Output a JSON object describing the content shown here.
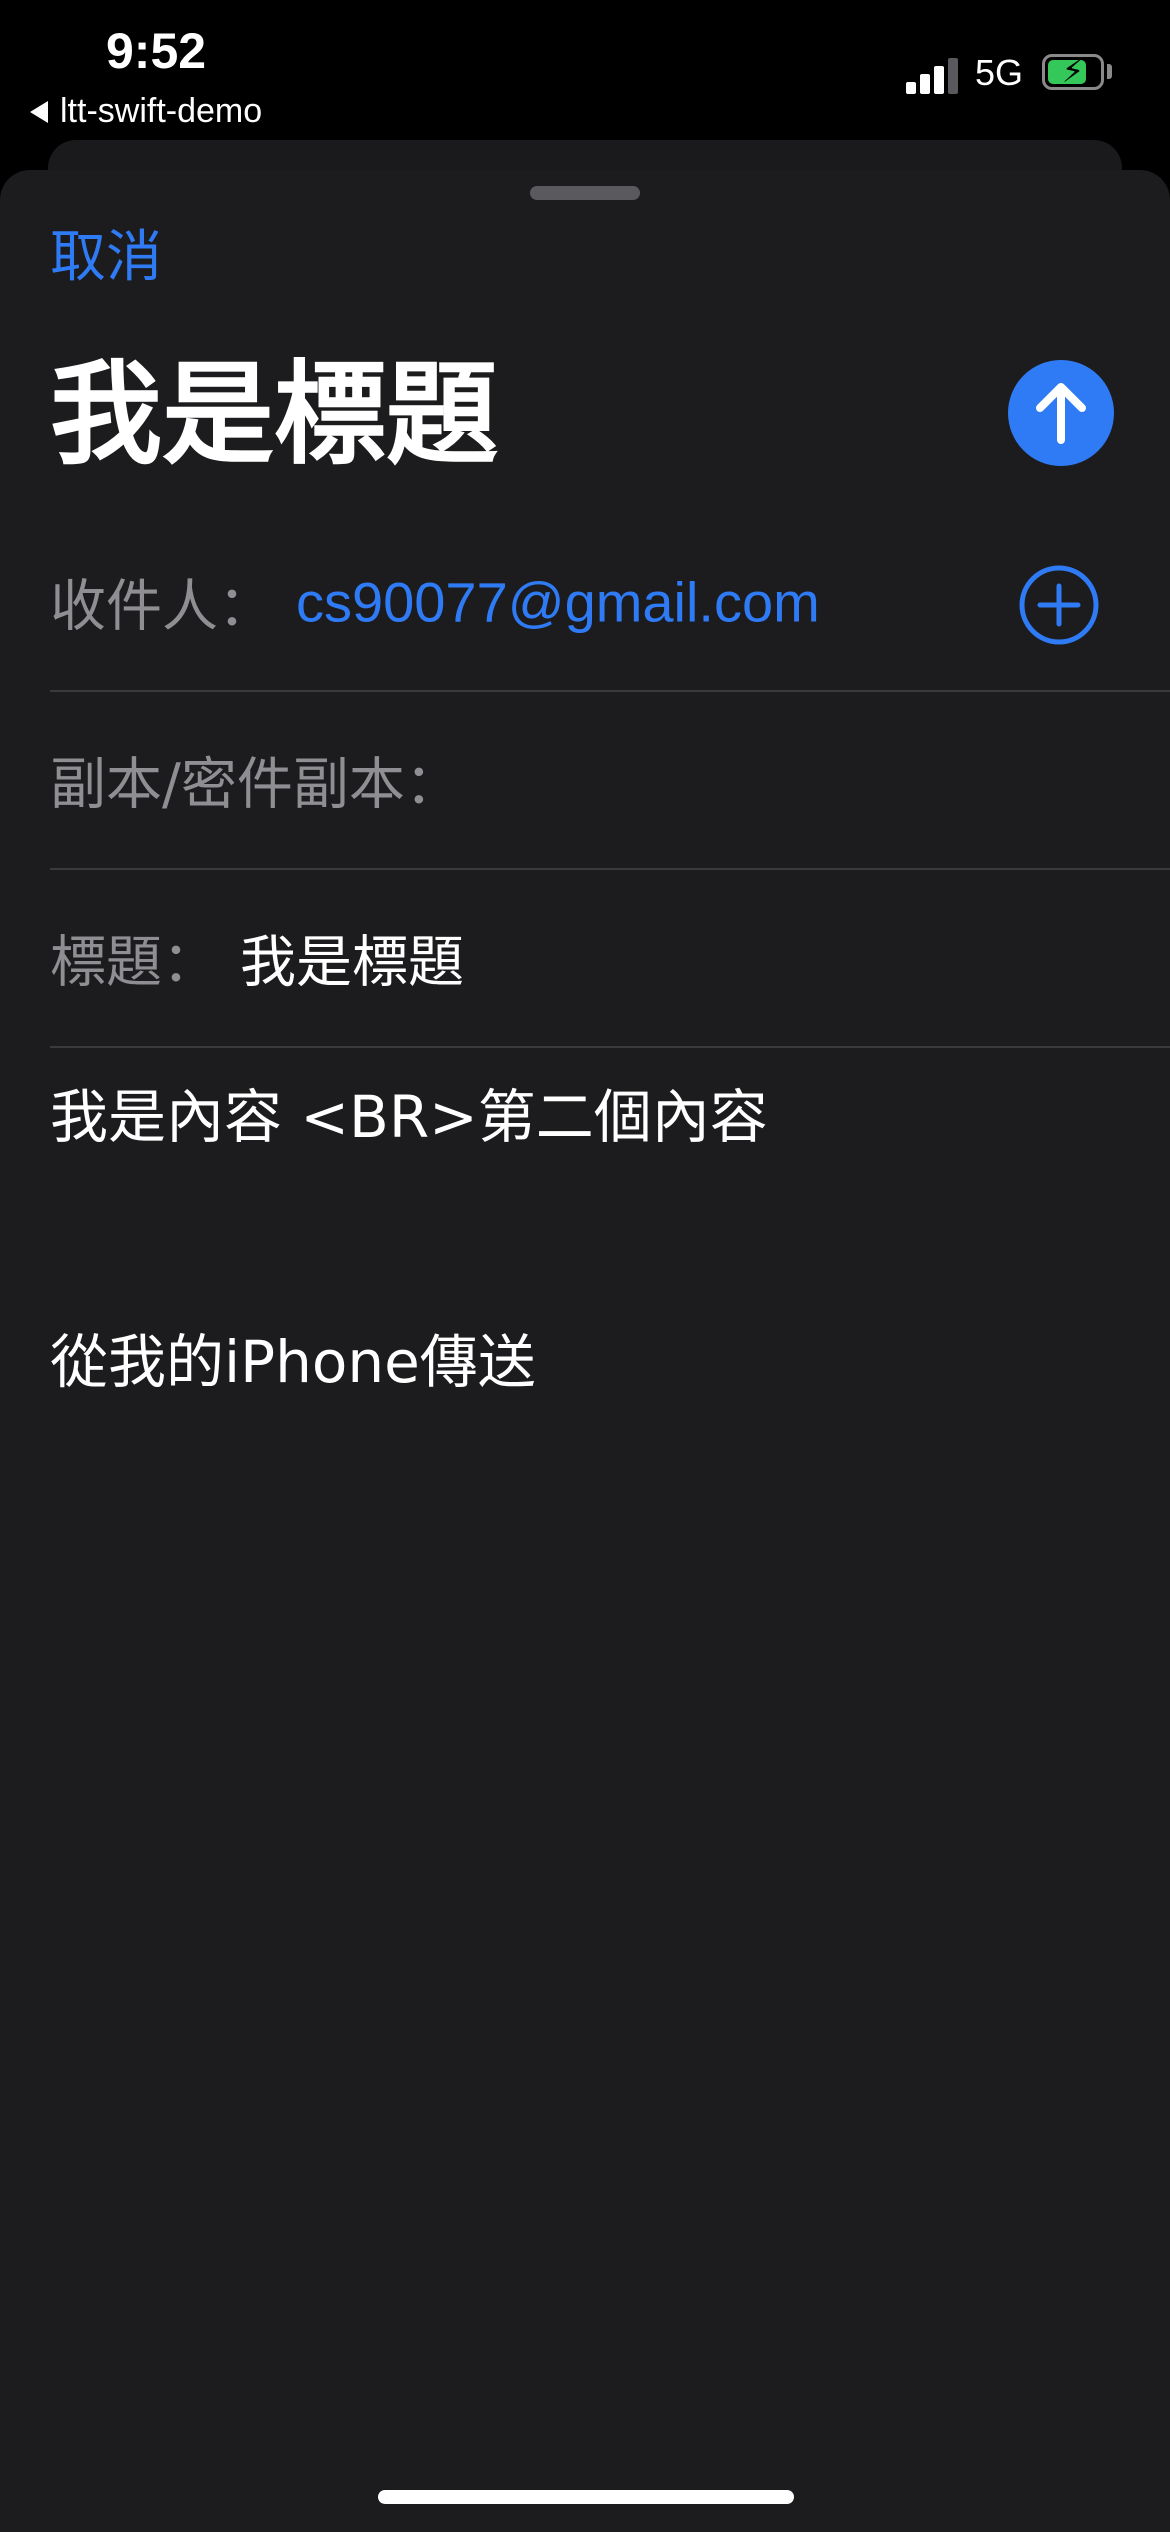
{
  "status_bar": {
    "time": "9:52",
    "back_app": "ltt-swift-demo",
    "network": "5G",
    "signal_bars": 3,
    "battery_level": 0.75,
    "battery_charging": true,
    "battery_color": "#34c759"
  },
  "header": {
    "cancel_label": "取消",
    "title": "我是標題",
    "send_icon": "arrow-up-icon"
  },
  "fields": {
    "to_label": "收件人：",
    "to_value": "cs90077@gmail.com",
    "add_icon": "plus-circle-icon",
    "cc_label": "副本/密件副本：",
    "subject_label": "標題：",
    "subject_value": "我是標題"
  },
  "body": {
    "line1": "我是內容 <BR>第二個內容",
    "signature": "從我的iPhone傳送"
  },
  "colors": {
    "accent": "#2f7bf5",
    "sheet_background": "#1c1c1e",
    "label_gray": "#8e8e93"
  }
}
